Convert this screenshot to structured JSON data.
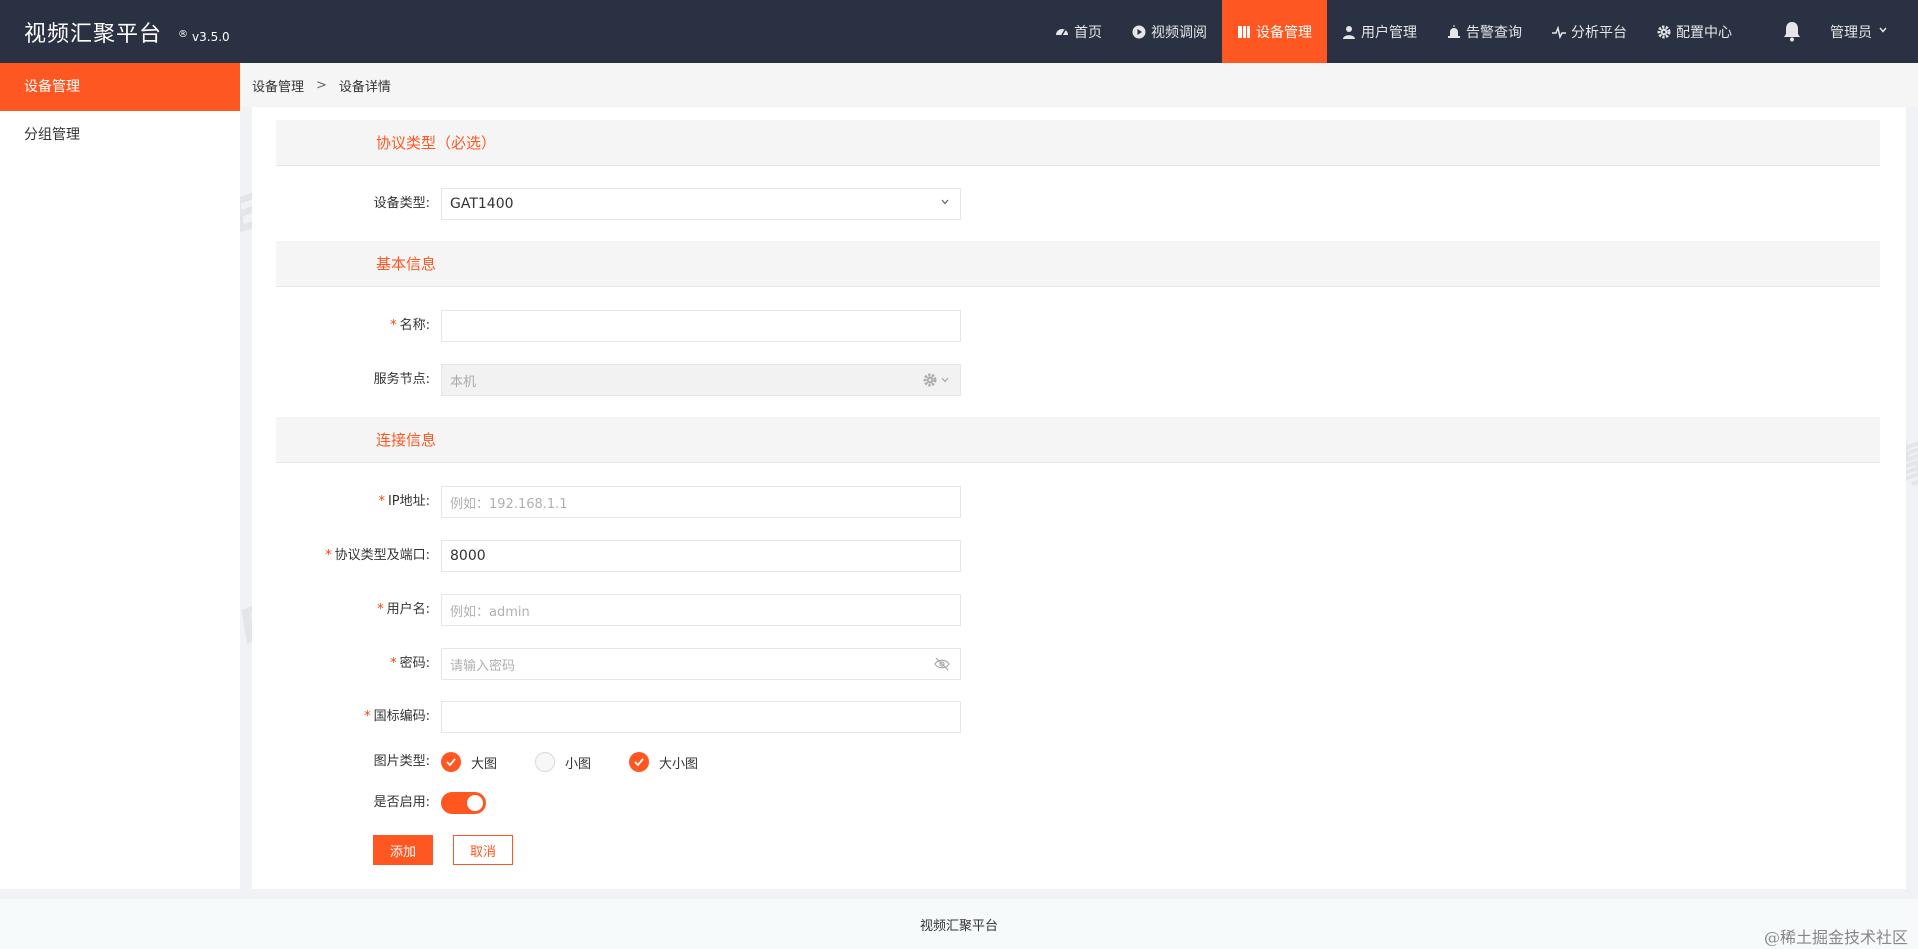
{
  "brand": {
    "title": "视频汇聚平台",
    "registered": "®",
    "version": "v3.5.0"
  },
  "nav": {
    "items": [
      {
        "label": "首页",
        "icon": "dashboard-icon"
      },
      {
        "label": "视频调阅",
        "icon": "play-circle-icon"
      },
      {
        "label": "设备管理",
        "icon": "device-icon",
        "active": true
      },
      {
        "label": "用户管理",
        "icon": "user-icon"
      },
      {
        "label": "告警查询",
        "icon": "alarm-icon"
      },
      {
        "label": "分析平台",
        "icon": "pulse-icon"
      },
      {
        "label": "配置中心",
        "icon": "gear-icon"
      }
    ],
    "user_label": "管理员"
  },
  "sidebar": {
    "items": [
      {
        "label": "设备管理",
        "active": true
      },
      {
        "label": "分组管理"
      }
    ]
  },
  "breadcrumb": {
    "parent": "设备管理",
    "separator": ">",
    "current": "设备详情"
  },
  "sections": {
    "protocol": "协议类型（必选）",
    "basic": "基本信息",
    "connection": "连接信息"
  },
  "form": {
    "device_type": {
      "label": "设备类型:",
      "value": "GAT1400"
    },
    "name": {
      "label": "名称:",
      "value": ""
    },
    "service_node": {
      "label": "服务节点:",
      "value": "本机"
    },
    "ip": {
      "label": "IP地址:",
      "placeholder": "例如：192.168.1.1"
    },
    "port": {
      "label": "协议类型及端口:",
      "value": "8000"
    },
    "username": {
      "label": "用户名:",
      "placeholder": "例如：admin"
    },
    "password": {
      "label": "密码:",
      "placeholder": "请输入密码"
    },
    "gb_code": {
      "label": "国标编码:",
      "value": ""
    },
    "image_type": {
      "label": "图片类型:",
      "options": [
        {
          "label": "大图",
          "checked": true
        },
        {
          "label": "小图",
          "checked": false
        },
        {
          "label": "大小图",
          "checked": true
        }
      ]
    },
    "enabled": {
      "label": "是否启用:",
      "on": true
    }
  },
  "buttons": {
    "add": "添加",
    "cancel": "取消"
  },
  "footer": {
    "text": "视频汇聚平台"
  },
  "corner_watermark": "@稀土掘金技术社区",
  "watermark_text": "TSINGSEE 青犀视频",
  "colors": {
    "accent": "#ff5722",
    "header_bg": "#2a3142"
  }
}
